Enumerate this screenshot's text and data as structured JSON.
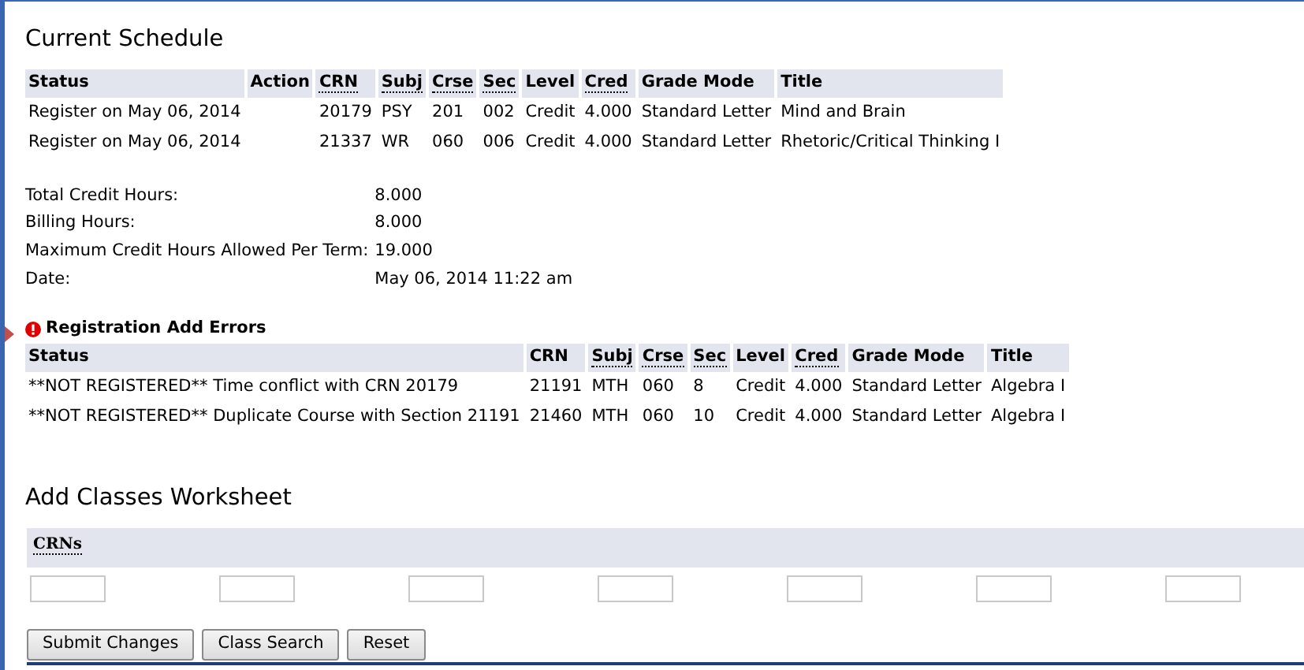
{
  "current_schedule": {
    "title": "Current Schedule",
    "columns": [
      {
        "label": "Status",
        "abbreviated": false
      },
      {
        "label": "Action",
        "abbreviated": false
      },
      {
        "label": "CRN",
        "abbreviated": true
      },
      {
        "label": "Subj",
        "abbreviated": true
      },
      {
        "label": "Crse",
        "abbreviated": true
      },
      {
        "label": "Sec",
        "abbreviated": true
      },
      {
        "label": "Level",
        "abbreviated": false
      },
      {
        "label": "Cred",
        "abbreviated": true
      },
      {
        "label": "Grade Mode",
        "abbreviated": false
      },
      {
        "label": "Title",
        "abbreviated": false
      }
    ],
    "rows": [
      [
        "Register on May 06, 2014",
        "",
        "20179",
        "PSY",
        "201",
        "002",
        "Credit",
        "4.000",
        "Standard Letter",
        "Mind and Brain"
      ],
      [
        "Register on May 06, 2014",
        "",
        "21337",
        "WR",
        "060",
        "006",
        "Credit",
        "4.000",
        "Standard Letter",
        "Rhetoric/Critical Thinking I"
      ]
    ],
    "summary": [
      {
        "label": "Total Credit Hours:",
        "value": "8.000"
      },
      {
        "label": "Billing Hours:",
        "value": "8.000"
      },
      {
        "label": "Maximum Credit Hours Allowed Per Term:",
        "value": "19.000"
      },
      {
        "label": "Date:",
        "value": "May 06, 2014 11:22 am"
      }
    ]
  },
  "errors": {
    "title": "Registration Add Errors",
    "columns": [
      {
        "label": "Status",
        "abbreviated": false
      },
      {
        "label": "CRN",
        "abbreviated": false
      },
      {
        "label": "Subj",
        "abbreviated": true
      },
      {
        "label": "Crse",
        "abbreviated": true
      },
      {
        "label": "Sec",
        "abbreviated": true
      },
      {
        "label": "Level",
        "abbreviated": false
      },
      {
        "label": "Cred",
        "abbreviated": true
      },
      {
        "label": "Grade Mode",
        "abbreviated": false
      },
      {
        "label": "Title",
        "abbreviated": false
      }
    ],
    "rows": [
      [
        "**NOT REGISTERED** Time conflict with CRN 20179",
        "21191",
        "MTH",
        "060",
        "8",
        "Credit",
        "4.000",
        "Standard Letter",
        "Algebra I"
      ],
      [
        "**NOT REGISTERED** Duplicate Course with Section 21191",
        "21460",
        "MTH",
        "060",
        "10",
        "Credit",
        "4.000",
        "Standard Letter",
        "Algebra I"
      ]
    ]
  },
  "worksheet": {
    "title": "Add Classes Worksheet",
    "header": {
      "label": "CRNs",
      "abbreviated": true
    },
    "crn_fields": [
      {
        "kind": "text"
      },
      {
        "kind": "text"
      },
      {
        "kind": "text"
      },
      {
        "kind": "text"
      },
      {
        "kind": "text"
      },
      {
        "kind": "text"
      },
      {
        "kind": "text"
      }
    ]
  },
  "buttons": [
    "Submit Changes",
    "Class Search",
    "Reset"
  ]
}
